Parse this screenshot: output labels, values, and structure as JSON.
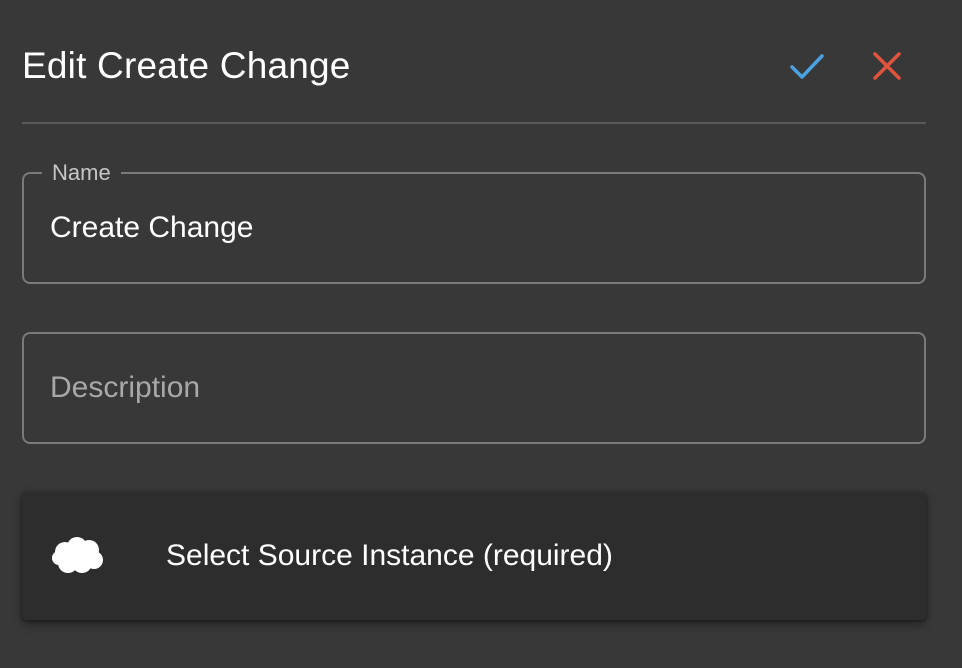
{
  "dialog": {
    "title": "Edit Create Change",
    "confirm_icon": "check-icon",
    "cancel_icon": "close-icon",
    "colors": {
      "confirm": "#4aa3e0",
      "cancel": "#e0543e",
      "background": "#383838",
      "card": "#2d2d2d"
    }
  },
  "fields": {
    "name": {
      "label": "Name",
      "value": "Create Change"
    },
    "description": {
      "placeholder": "Description",
      "value": ""
    }
  },
  "source": {
    "icon": "cloud-icon",
    "label": "Select Source Instance (required)"
  }
}
